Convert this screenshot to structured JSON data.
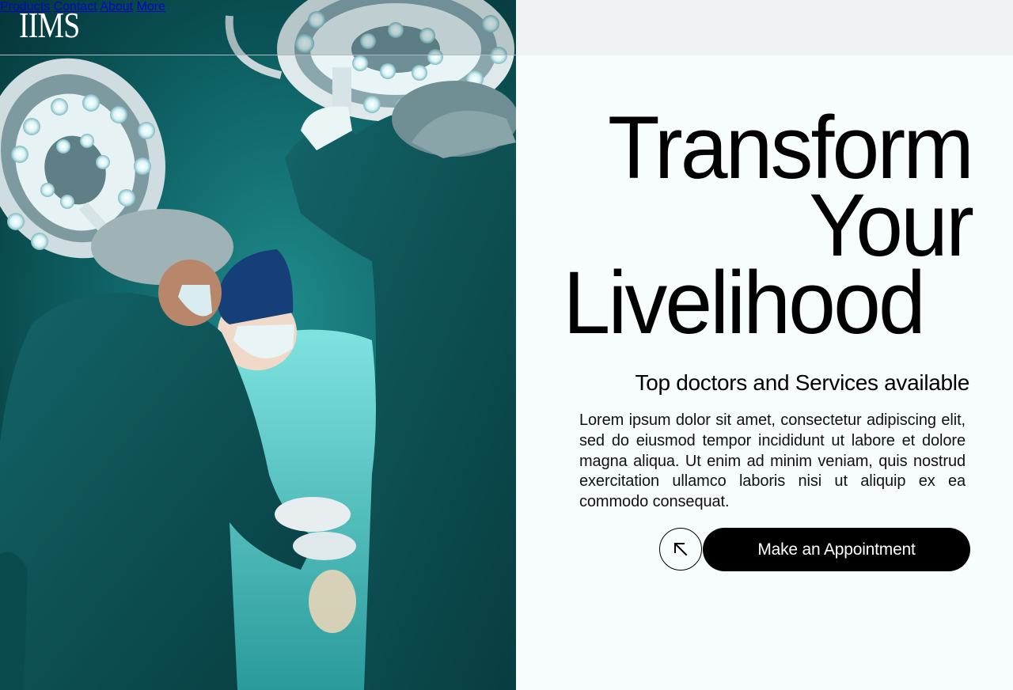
{
  "brand": {
    "logo_text": "IIMS"
  },
  "nav": {
    "items": [
      {
        "label": "Products"
      },
      {
        "label": "Contact"
      },
      {
        "label": "About"
      },
      {
        "label": "More"
      }
    ]
  },
  "hero": {
    "headline_line1": "Transform",
    "headline_line2": "Your",
    "headline_line3": "Livelihood",
    "subheading": "Top doctors and Services available",
    "description": "Lorem ipsum dolor sit amet, consectetur adipiscing elit, sed do eiusmod tempor incididunt ut labore et dolore magna aliqua. Ut enim ad minim veniam, quis nostrud exercitation ullamco laboris nisi ut aliquip ex ea commodo consequat.",
    "cta_label": "Make an Appointment",
    "arrow_icon": "arrow-up-left-icon"
  },
  "colors": {
    "background": "#f7fdfd",
    "header_bg": "#f0f3f3",
    "cta_bg": "#000000",
    "cta_text": "#ffffff",
    "photo_teal": "#0b4e51"
  }
}
